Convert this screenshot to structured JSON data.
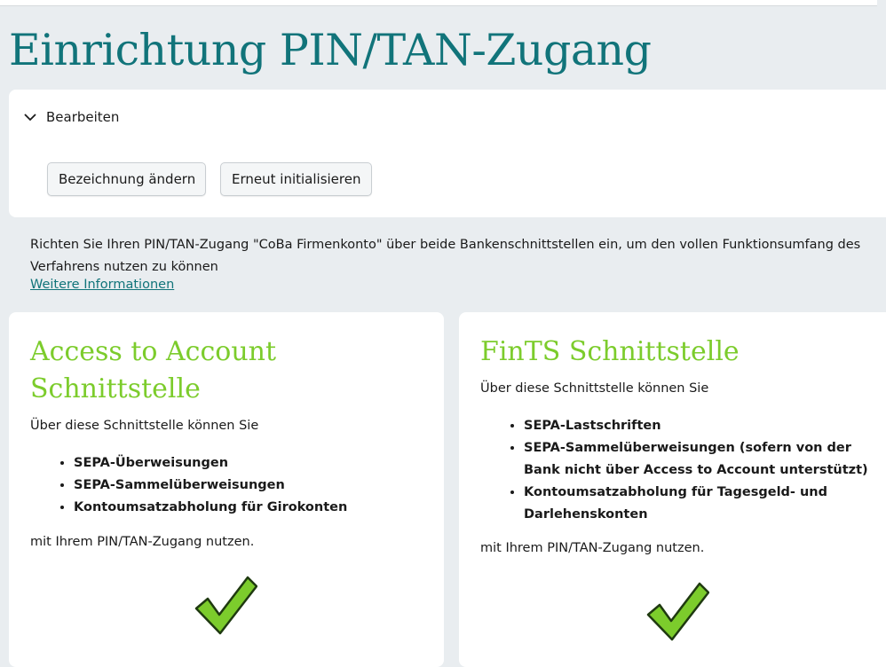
{
  "page": {
    "title": "Einrichtung PIN/TAN-Zugang"
  },
  "edit_panel": {
    "toggle_label": "Bearbeiten",
    "rename_button": "Bezeichnung ändern",
    "reinit_button": "Erneut initialisieren"
  },
  "intro": {
    "text": "Richten Sie Ihren PIN/TAN-Zugang \"CoBa Firmenkonto\" über beide Bankenschnittstellen ein, um den vollen Funktionsumfang des Verfahrens nutzen zu können",
    "link": "Weitere Informationen"
  },
  "cards": {
    "a2a": {
      "title": "Access to Account Schnittstelle",
      "lead": "Über diese Schnittstelle können Sie",
      "items": [
        "SEPA-Überweisungen",
        "SEPA-Sammelüberweisungen",
        "Kontoumsatzabholung für Girokonten"
      ],
      "tail": "mit Ihrem PIN/TAN-Zugang nutzen.",
      "status_icon": "checkmark-icon"
    },
    "fints": {
      "title": "FinTS Schnittstelle",
      "lead": "Über diese Schnittstelle können Sie",
      "items": [
        "SEPA-Lastschriften",
        "SEPA-Sammelüberweisungen (sofern von der Bank nicht über Access to Account unterstützt)",
        "Kontoumsatzabholung für Tagesgeld- und Darlehenskonten"
      ],
      "tail": "mit Ihrem PIN/TAN-Zugang nutzen.",
      "status_icon": "checkmark-icon"
    }
  },
  "colors": {
    "heading": "#11747a",
    "card_title": "#7ccc2c",
    "check": "#7ccc2c",
    "background": "#e9edf0"
  }
}
